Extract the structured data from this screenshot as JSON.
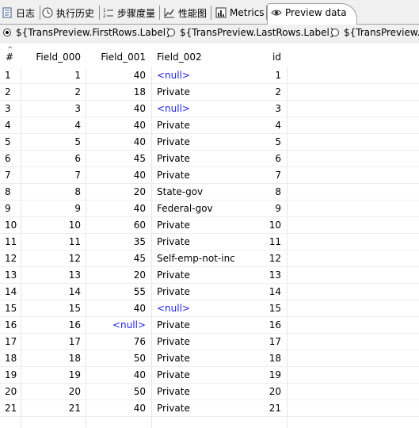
{
  "tabs": [
    {
      "label": "日志",
      "icon": "log-icon"
    },
    {
      "label": "执行历史",
      "icon": "history-icon"
    },
    {
      "label": "步骤度量",
      "icon": "step-metrics-icon"
    },
    {
      "label": "性能图",
      "icon": "performance-graph-icon"
    },
    {
      "label": "Metrics",
      "icon": "metrics-icon"
    },
    {
      "label": "Preview data",
      "icon": "preview-eye-icon",
      "active": true
    }
  ],
  "preview_options": [
    {
      "label": "${TransPreview.FirstRows.Label}",
      "selected": true
    },
    {
      "label": "${TransPreview.LastRows.Label}",
      "selected": false
    },
    {
      "label": "${TransPreview.O",
      "selected": false
    }
  ],
  "grid": {
    "columns": [
      "#",
      "Field_000",
      "Field_001",
      "Field_002",
      "id"
    ],
    "null_text": "<null>",
    "null_color": "#2222ee",
    "rows": [
      [
        "1",
        "1",
        "40",
        "<null>",
        "1"
      ],
      [
        "2",
        "2",
        "18",
        "Private",
        "2"
      ],
      [
        "3",
        "3",
        "40",
        "<null>",
        "3"
      ],
      [
        "4",
        "4",
        "40",
        "Private",
        "4"
      ],
      [
        "5",
        "5",
        "40",
        "Private",
        "5"
      ],
      [
        "6",
        "6",
        "45",
        "Private",
        "6"
      ],
      [
        "7",
        "7",
        "40",
        "Private",
        "7"
      ],
      [
        "8",
        "8",
        "20",
        "State-gov",
        "8"
      ],
      [
        "9",
        "9",
        "40",
        "Federal-gov",
        "9"
      ],
      [
        "10",
        "10",
        "60",
        "Private",
        "10"
      ],
      [
        "11",
        "11",
        "35",
        "Private",
        "11"
      ],
      [
        "12",
        "12",
        "45",
        "Self-emp-not-inc",
        "12"
      ],
      [
        "13",
        "13",
        "20",
        "Private",
        "13"
      ],
      [
        "14",
        "14",
        "55",
        "Private",
        "14"
      ],
      [
        "15",
        "15",
        "40",
        "<null>",
        "15"
      ],
      [
        "16",
        "16",
        "<null>",
        "Private",
        "16"
      ],
      [
        "17",
        "17",
        "76",
        "Private",
        "17"
      ],
      [
        "18",
        "18",
        "50",
        "Private",
        "18"
      ],
      [
        "19",
        "19",
        "40",
        "Private",
        "19"
      ],
      [
        "20",
        "20",
        "50",
        "Private",
        "20"
      ],
      [
        "21",
        "21",
        "40",
        "Private",
        "21"
      ]
    ]
  }
}
